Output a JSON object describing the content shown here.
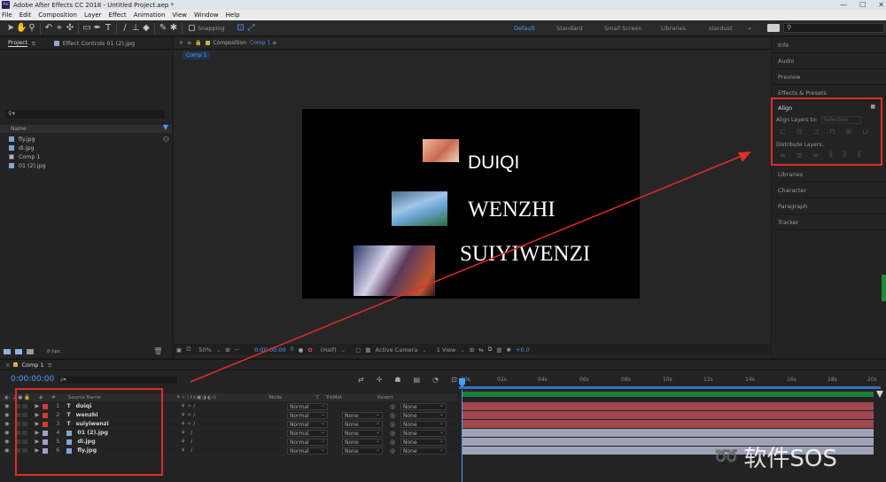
{
  "app": {
    "title": "Adobe After Effects CC 2018 - Untitled Project.aep *",
    "logo": "Ae"
  },
  "window_controls": [
    "—",
    "☐",
    "✕"
  ],
  "menu": [
    "File",
    "Edit",
    "Composition",
    "Layer",
    "Effect",
    "Animation",
    "View",
    "Window",
    "Help"
  ],
  "toolbar": {
    "snapping_label": "Snapping",
    "workspaces": [
      "Default",
      "Standard",
      "Small Screen",
      "Libraries",
      "stardust"
    ],
    "active_workspace": "Default",
    "search_placeholder": "",
    "more": "»"
  },
  "project_panel": {
    "tab_project": "Project",
    "tab_effect_controls": "Effect Controls 01 (2).jpg",
    "name_header": "Name",
    "items": [
      {
        "name": "fly.jpg",
        "icon": "image-file-icon"
      },
      {
        "name": "di.jpg",
        "icon": "image-file-icon"
      },
      {
        "name": "Comp 1",
        "icon": "composition-icon"
      },
      {
        "name": "01 (2).jpg",
        "icon": "image-file-icon"
      }
    ],
    "bpc": "8 bpc"
  },
  "composition_panel": {
    "tab_label": "Composition",
    "tab_comp": "Comp 1",
    "breadcrumb": "Comp 1",
    "canvas_texts": [
      "DUIQI",
      "WENZHI",
      "SUIYIWENZI"
    ],
    "zoom": "50%",
    "timecode": "0:00:00:00",
    "resolution": "(Half)",
    "camera": "Active Camera",
    "view": "1 View",
    "exposure": "+0.0"
  },
  "right_panel": {
    "sections": [
      "Info",
      "Audio",
      "Preview",
      "Effects & Presets"
    ],
    "align": {
      "title": "Align",
      "align_layers_to": "Align Layers to:",
      "selection": "Selection",
      "distribute_layers": "Distribute Layers:"
    },
    "sections_after": [
      "Libraries",
      "Character",
      "Paragraph",
      "Tracker"
    ]
  },
  "timeline": {
    "tab": "Comp 1",
    "timecode": "0:00:00:00",
    "search_placeholder": "ρ▾",
    "col_hash": "#",
    "col_source": "Source Name",
    "col_mode": "Mode",
    "col_t": "T",
    "col_trkmat": "TrkMat",
    "col_parent": "Parent",
    "ruler": [
      "00s",
      "02s",
      "04s",
      "06s",
      "08s",
      "10s",
      "12s",
      "14s",
      "16s",
      "18s",
      "20s"
    ],
    "layers": [
      {
        "num": "1",
        "type": "T",
        "name": "duiqi",
        "mode": "Normal",
        "trkmat": "",
        "parent": "None",
        "label_color": "#d03a3a"
      },
      {
        "num": "2",
        "type": "T",
        "name": "wenzhi",
        "mode": "Normal",
        "trkmat": "None",
        "parent": "None",
        "label_color": "#d03a3a"
      },
      {
        "num": "3",
        "type": "T",
        "name": "suiyiwenzi",
        "mode": "Normal",
        "trkmat": "None",
        "parent": "None",
        "label_color": "#d03a3a"
      },
      {
        "num": "4",
        "type": "img",
        "name": "01 (2).jpg",
        "mode": "Normal",
        "trkmat": "None",
        "parent": "None",
        "label_color": "#9da3c4"
      },
      {
        "num": "5",
        "type": "img",
        "name": "di.jpg",
        "mode": "Normal",
        "trkmat": "None",
        "parent": "None",
        "label_color": "#9da3c4"
      },
      {
        "num": "6",
        "type": "img",
        "name": "fly.jpg",
        "mode": "Normal",
        "trkmat": "None",
        "parent": "None",
        "label_color": "#9da3c4"
      }
    ]
  },
  "colors": {
    "accent": "#4b9bff",
    "highlight_red": "#e02b2b",
    "text_layer_bar": "#a0484e",
    "image_layer_bar": "#9ea2b7"
  },
  "watermark": "软件SOS"
}
